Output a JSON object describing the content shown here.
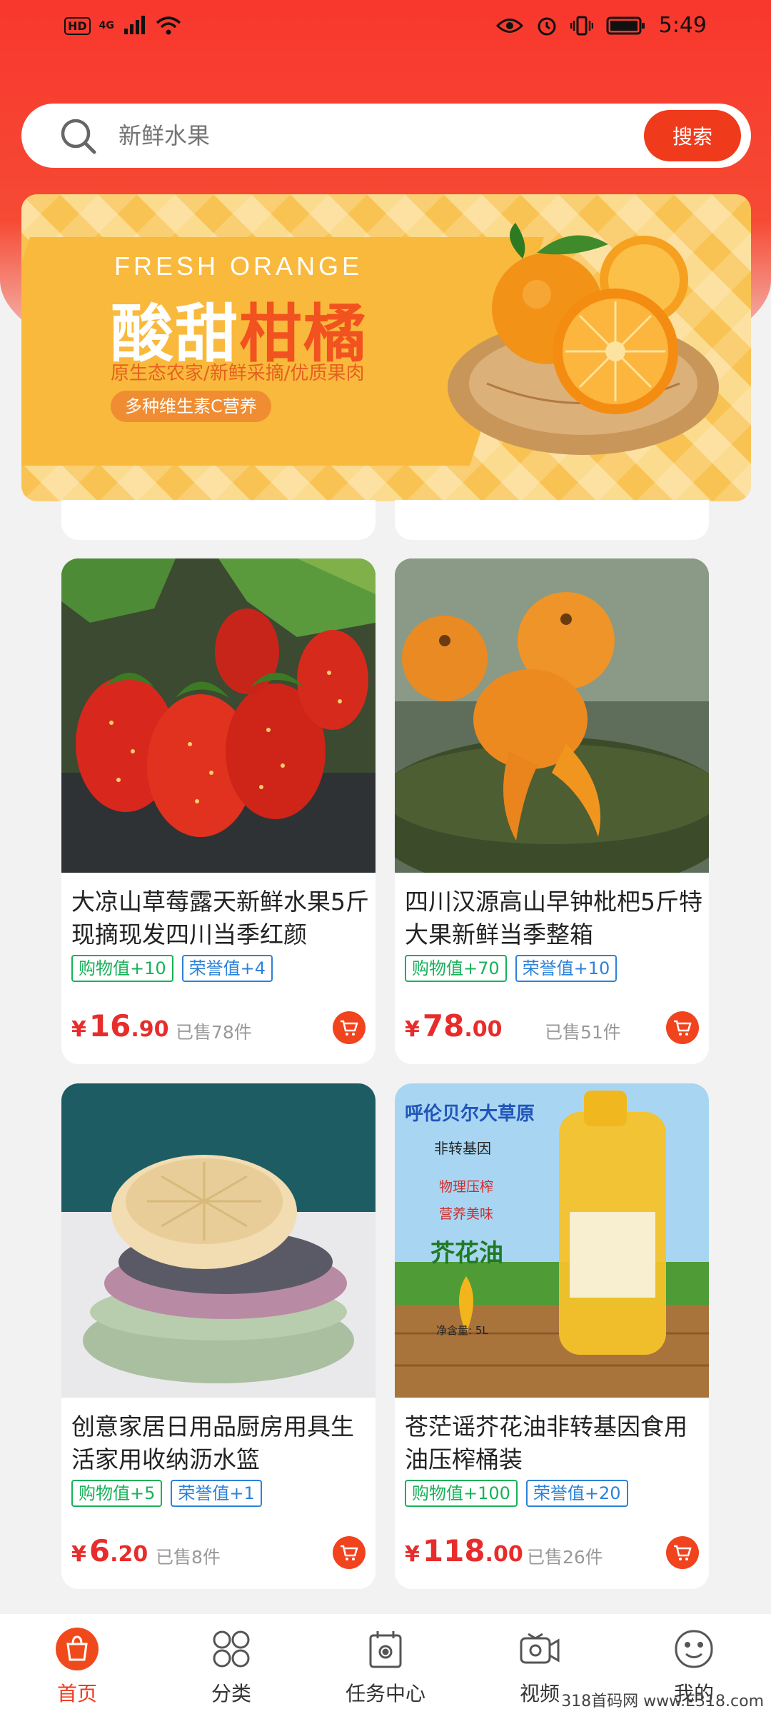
{
  "status_bar": {
    "hd": "HD",
    "signal": "4G",
    "time": "5:49"
  },
  "search": {
    "placeholder": "新鲜水果",
    "button_label": "搜索"
  },
  "banner": {
    "en_title": "FRESH ORANGE",
    "title_plain": "酸甜",
    "title_highlight": "柑橘",
    "subtitle": "原生态农家/新鲜采摘/优质果肉",
    "pill": "多种维生素C营养"
  },
  "products": [
    {
      "title": "大凉山草莓露天新鲜水果5斤现摘现发四川当季红颜",
      "tag_shopping": "购物值+10",
      "tag_honor": "荣誉值+4",
      "yen": "¥",
      "price_int": "16",
      "price_dec": ".90",
      "sold": "已售78件"
    },
    {
      "title": "四川汉源高山早钟枇杷5斤特大果新鲜当季整箱",
      "tag_shopping": "购物值+70",
      "tag_honor": "荣誉值+10",
      "yen": "¥",
      "price_int": "78",
      "price_dec": ".00",
      "sold": "已售51件"
    },
    {
      "title": "创意家居日用品厨房用具生活家用收纳沥水篮",
      "tag_shopping": "购物值+5",
      "tag_honor": "荣誉值+1",
      "yen": "¥",
      "price_int": "6",
      "price_dec": ".20",
      "sold": "已售8件"
    },
    {
      "title": "苍茫谣芥花油非转基因食用油压榨桶装",
      "tag_shopping": "购物值+100",
      "tag_honor": "荣誉值+20",
      "yen": "¥",
      "price_int": "118",
      "price_dec": ".00",
      "sold": "已售26件",
      "image_text": {
        "brand": "呼伦贝尔大草原",
        "line1": "非转基因",
        "line2": "物理压榨",
        "line3": "营养美味",
        "oil": "芥花油",
        "volume": "净含量: 5L"
      }
    }
  ],
  "bottom_nav": [
    {
      "label": "首页",
      "icon": "shopping-bag-icon",
      "active": true
    },
    {
      "label": "分类",
      "icon": "grid-icon",
      "active": false
    },
    {
      "label": "任务中心",
      "icon": "calendar-gear-icon",
      "active": false
    },
    {
      "label": "视频",
      "icon": "video-camera-icon",
      "active": false
    },
    {
      "label": "我的",
      "icon": "smiley-icon",
      "active": false
    }
  ],
  "watermark": "318首码网 www.E318.com",
  "colors": {
    "accent": "#f03a1c",
    "price": "#e82c2c",
    "tag_green": "#18b15a",
    "tag_blue": "#2c82d8"
  }
}
